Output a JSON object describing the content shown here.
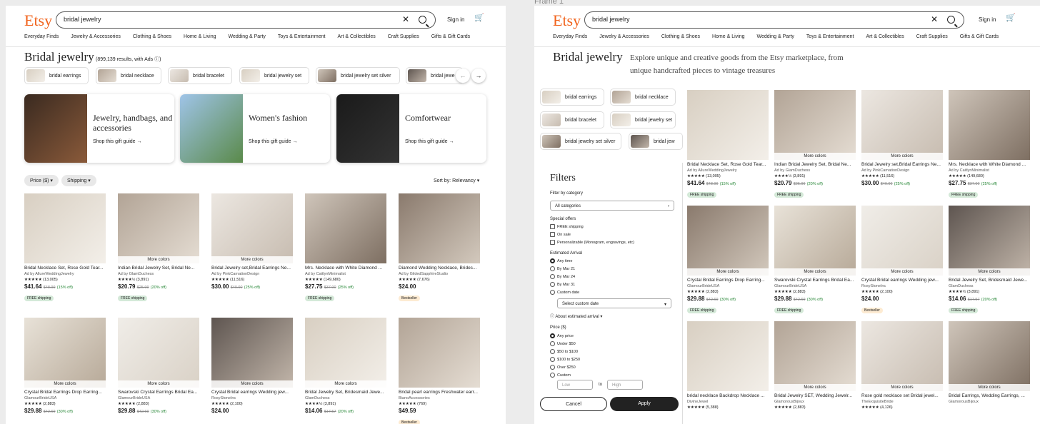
{
  "frame2_label": "Frame 1",
  "header": {
    "logo": "Etsy",
    "search": "bridal jewelry",
    "signin": "Sign in",
    "categories": [
      "Everyday Finds",
      "Jewelry & Accessories",
      "Clothing & Shoes",
      "Home & Living",
      "Wedding & Party",
      "Toys & Entertainment",
      "Art & Collectibles",
      "Craft Supplies",
      "Gifts & Gift Cards"
    ]
  },
  "frame1": {
    "title": "Bridal jewelry",
    "results": "(899,139 results, with Ads",
    "chips": [
      "bridal earrings",
      "bridal necklace",
      "bridal bracelet",
      "bridal jewelry set",
      "bridal jewelry set silver",
      "bridal jewe"
    ],
    "cards": [
      {
        "title": "Jewelry, handbags, and accessories",
        "link": "Shop this gift guide"
      },
      {
        "title": "Women's fashion",
        "link": "Shop this gift guide"
      },
      {
        "title": "Comfortwear",
        "link": "Shop this gift guide"
      }
    ],
    "filters": [
      "Price ($)",
      "Shipping"
    ],
    "sort": "Sort by: Relevancy",
    "products": [
      {
        "t": "Bridal Necklace Set, Rose Gold Tear...",
        "s": "Ad by AllureWeddingJewelry",
        "r": "★★★★★ (13,005)",
        "p": "$41.64",
        "o": "$48.99",
        "d": "(15% off)",
        "b": "FREE shipping",
        "mc": ""
      },
      {
        "t": "Indian Bridal Jewelry Set, Bridal Ne...",
        "s": "Ad by GlamDuchess",
        "r": "★★★★½ (3,891)",
        "p": "$20.79",
        "o": "$25.99",
        "d": "(20% off)",
        "b": "FREE shipping",
        "mc": "More colors"
      },
      {
        "t": "Bridal Jewelry set,Bridal Earrings Ne...",
        "s": "Ad by PinkCarnationDesign",
        "r": "★★★★★ (11,516)",
        "p": "$30.00",
        "o": "$40.00",
        "d": "(25% off)",
        "b": "",
        "mc": "More colors"
      },
      {
        "t": "Mrs. Necklace with White Diamond ...",
        "s": "Ad by CaitlynMinimalist",
        "r": "★★★★★ (149,680)",
        "p": "$27.75",
        "o": "$37.00",
        "d": "(25% off)",
        "b": "FREE shipping",
        "mc": ""
      },
      {
        "t": "Diamond Wedding Necklace, Brides...",
        "s": "Ad by GildedSapphireStudio",
        "r": "★★★★★ (7,676)",
        "p": "$24.00",
        "o": "",
        "d": "",
        "bs": "Bestseller",
        "mc": ""
      },
      {
        "t": "Crystal Bridal Earrings Drop Earring...",
        "s": "GlamourBrideUSA",
        "r": "★★★★★ (2,883)",
        "p": "$29.88",
        "o": "$42.69",
        "d": "(30% off)",
        "b": "",
        "mc": "More colors"
      },
      {
        "t": "Swarovski Crystal Earrings Bridal Ea...",
        "s": "GlamourBrideUSA",
        "r": "★★★★★ (2,883)",
        "p": "$29.88",
        "o": "$42.69",
        "d": "(30% off)",
        "b": "",
        "mc": "More colors"
      },
      {
        "t": "Crystal Bridal earrings Wedding jew...",
        "s": "RosyStoneInc",
        "r": "★★★★★ (2,100)",
        "p": "$24.00",
        "o": "",
        "d": "",
        "b": "",
        "mc": "More colors"
      },
      {
        "t": "Bridal Jewelry Set, Bridesmaid Jewe...",
        "s": "GlamDuchess",
        "r": "★★★★½ (3,891)",
        "p": "$14.06",
        "o": "$17.57",
        "d": "(20% off)",
        "b": "",
        "mc": "More colors"
      },
      {
        "t": "Bridal pearl earrings Freshwater earr...",
        "s": "BianoAccessories",
        "r": "★★★★★ (769)",
        "p": "$49.59",
        "o": "",
        "d": "",
        "bs": "Bestseller",
        "mc": ""
      }
    ]
  },
  "frame2": {
    "title": "Bridal jewelry",
    "subtitle": "Explore unique and creative goods from the Etsy marketplace, from unique handcrafted pieces to vintage treasures",
    "chips": [
      "bridal earrings",
      "bridal necklace",
      "bridal bracelet",
      "bridal jewelry set",
      "bridal jewelry set silver",
      "bridal jew"
    ],
    "filters": {
      "title": "Filters",
      "by_category": "Filter by category",
      "all": "All categories",
      "special": "Special offers",
      "special_opts": [
        "FREE shipping",
        "On sale",
        "Personalizable (Monogram, engravings, etc)"
      ],
      "arrival": "Estimated Arrival",
      "arrival_opts": [
        "Any time",
        "By Mar 21",
        "By Mar 24",
        "By Mar 31",
        "Custom date"
      ],
      "custom_date": "Select custom date",
      "about": "About estimated arrival",
      "price": "Price ($)",
      "price_opts": [
        "Any price",
        "Under $50",
        "$50 to $100",
        "$100 to $250",
        "Over $250",
        "Custom"
      ],
      "low": "Low",
      "to": "to",
      "high": "High",
      "cancel": "Cancel",
      "apply": "Apply"
    },
    "products": [
      {
        "t": "Bridal Necklace Set, Rose Gold Tear...",
        "s": "Ad by AllureWeddingJewelry",
        "r": "★★★★★ (13,005)",
        "p": "$41.64",
        "o": "$48.99",
        "d": "(15% off)",
        "b": "FREE shipping",
        "mc": ""
      },
      {
        "t": "Indian Bridal Jewelry Set, Bridal Ne...",
        "s": "Ad by GlamDuchess",
        "r": "★★★★½ (3,891)",
        "p": "$20.79",
        "o": "$25.99",
        "d": "(20% off)",
        "b": "FREE shipping",
        "mc": "More colors"
      },
      {
        "t": "Bridal Jewelry set,Bridal Earrings Ne...",
        "s": "Ad by PinkCarnationDesign",
        "r": "★★★★★ (11,516)",
        "p": "$30.00",
        "o": "$40.00",
        "d": "(25% off)",
        "b": "",
        "mc": "More colors"
      },
      {
        "t": "Mrs. Necklace with White Diamond ...",
        "s": "Ad by CaitlynMinimalist",
        "r": "★★★★★ (149,680)",
        "p": "$27.75",
        "o": "$37.00",
        "d": "(25% off)",
        "b": "FREE shipping",
        "mc": ""
      },
      {
        "t": "Crystal Bridal Earrings Drop Earring...",
        "s": "GlamourBrideUSA",
        "r": "★★★★★ (2,883)",
        "p": "$29.88",
        "o": "$42.69",
        "d": "(30% off)",
        "b": "FREE shipping",
        "mc": "More colors"
      },
      {
        "t": "Swarovski Crystal Earrings Bridal Ea...",
        "s": "GlamourBrideUSA",
        "r": "★★★★★ (2,883)",
        "p": "$29.88",
        "o": "$42.69",
        "d": "(30% off)",
        "b": "FREE shipping",
        "mc": "More colors"
      },
      {
        "t": "Crystal Bridal earrings Wedding jew...",
        "s": "RosyStoneInc",
        "r": "★★★★★ (2,100)",
        "p": "$24.00",
        "o": "",
        "d": "",
        "bs": "Bestseller",
        "mc": "More colors"
      },
      {
        "t": "Bridal Jewelry Set, Bridesmaid Jewe...",
        "s": "GlamDuchess",
        "r": "★★★★½ (3,891)",
        "p": "$14.06",
        "o": "$17.57",
        "d": "(20% off)",
        "b": "FREE shipping",
        "mc": "More colors"
      },
      {
        "t": "bridal necklace Backdrop Necklace ...",
        "s": "DivineJewel",
        "r": "★★★★★ (5,388)",
        "p": "",
        "o": "",
        "d": "",
        "b": "",
        "mc": ""
      },
      {
        "t": "Bridal Jewelry SET, Wedding Jewelr...",
        "s": "GlamorousBijoux",
        "r": "★★★★★ (2,883)",
        "p": "",
        "o": "",
        "d": "",
        "b": "",
        "mc": "More colors"
      },
      {
        "t": "Rose gold necklace set Bridal jewel...",
        "s": "TheExquisiteBride",
        "r": "★★★★★ (4,126)",
        "p": "",
        "o": "",
        "d": "",
        "b": "",
        "mc": "More colors"
      },
      {
        "t": "Bridal Earrings, Wedding Earrings, ...",
        "s": "GlamorousBijoux",
        "r": "",
        "p": "",
        "o": "",
        "d": "",
        "b": "",
        "mc": "More colors"
      }
    ]
  }
}
